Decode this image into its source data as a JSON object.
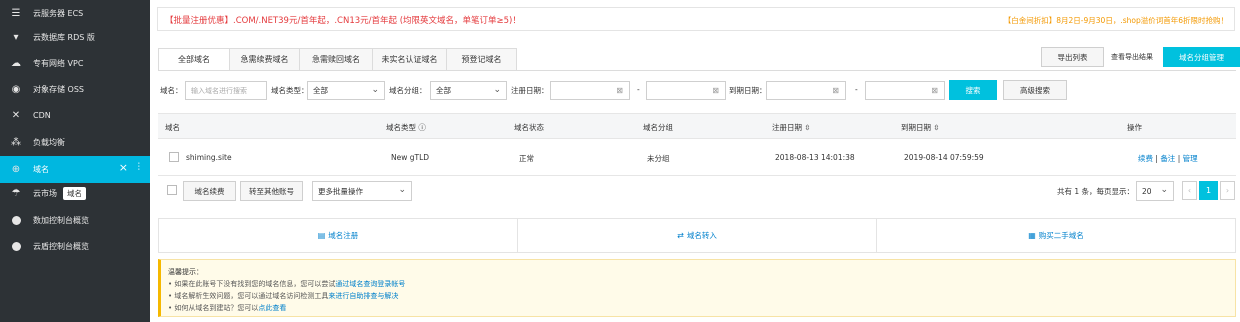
{
  "sidebar": {
    "items": [
      {
        "label": "云服务器 ECS",
        "icon": "server-icon"
      },
      {
        "label": "云数据库 RDS 版",
        "icon": "database-icon"
      },
      {
        "label": "专有网络 VPC",
        "icon": "cloud-icon"
      },
      {
        "label": "对象存储 OSS",
        "icon": "storage-icon"
      },
      {
        "label": "CDN",
        "icon": "cross-arrows-icon"
      },
      {
        "label": "负载均衡",
        "icon": "nodes-icon"
      },
      {
        "label": "域名",
        "icon": "globe-icon"
      },
      {
        "label": "云市场",
        "icon": "cart-icon",
        "tip": "域名"
      },
      {
        "label": "数加控制台概览",
        "icon": "dot-icon"
      },
      {
        "label": "云盾控制台概览",
        "icon": "dot-icon"
      }
    ],
    "active_close": "×",
    "active_pin": "⫶"
  },
  "promo": {
    "left": "【批量注册优惠】.COM/.NET39元/首年起，.CN13元/首年起 (均限英文域名，单笔订单≥5)！",
    "right": "【白金间折扣】8月2日-9月30日，.shop溢价词首年6折限时抢购！"
  },
  "tabs": [
    "全部域名",
    "急需续费域名",
    "急需赎回域名",
    "未实名认证域名",
    "预登记域名"
  ],
  "toolbar": {
    "export_list": "导出列表",
    "view_export": "查看导出结果",
    "group_manage": "域名分组管理"
  },
  "search": {
    "domain_label": "域名：",
    "domain_placeholder": "输入域名进行搜索",
    "type_label": "域名类型：",
    "type_value": "全部",
    "group_label": "域名分组：",
    "group_value": "全部",
    "reg_date_label": "注册日期：",
    "exp_date_label": "到期日期：",
    "dash": "-",
    "search_btn": "搜索",
    "advanced_btn": "高级搜索"
  },
  "table": {
    "headers": {
      "domain": "域名",
      "type": "域名类型",
      "status": "域名状态",
      "group": "域名分组",
      "reg_date": "注册日期",
      "exp_date": "到期日期",
      "actions": "操作"
    },
    "rows": [
      {
        "domain": "shiming.site",
        "type": "New gTLD",
        "status": "正常",
        "group": "未分组",
        "reg_date": "2018-08-13 14:01:38",
        "exp_date": "2019-08-14 07:59:59",
        "renew": "续费",
        "note": "备注",
        "manage": "管理",
        "sep": "|"
      }
    ]
  },
  "batch": {
    "renew": "域名续费",
    "transfer": "转至其他账号",
    "more": "更多批量操作"
  },
  "pager": {
    "summary": "共有 1 条，每页显示：",
    "page_size": "20",
    "prev": "‹",
    "current": "1",
    "next": "›"
  },
  "links": {
    "register": "域名注册",
    "transfer_in": "域名转入",
    "buy_second": "购买二手域名"
  },
  "tips": {
    "title": "温馨提示：",
    "t1_prefix": "• 如果在此账号下没有找到您的域名信息，您可以尝试",
    "t1_link": "通过域名查询登录帐号",
    "t2_prefix": "• 域名解析生效问题，您可以通过域名访问检测工具",
    "t2_link": "来进行自助排查与解决",
    "t3_prefix": "• 如何从域名到建站？您可以",
    "t3_link": "点此查看"
  }
}
